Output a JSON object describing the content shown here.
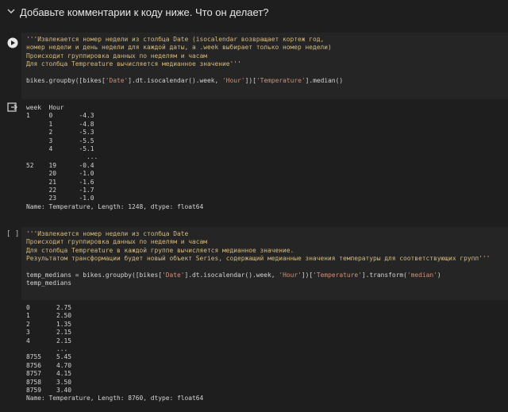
{
  "section": {
    "title": "Добавьте комментарии к коду ниже. Что он делает?"
  },
  "cell1": {
    "doc_lines": [
      "'''Извлекается номер недели из столбца Date (isocalendar возвращает кортеж год,",
      "номер недели и день недели для каждой даты, а .week выбирает только номер недели)",
      "Происходит группировка данных по неделям и часам",
      "Для столбца Tempreature вычисляется медианное значение'''"
    ],
    "code": {
      "p1": "bikes.groupby([bikes[",
      "s1": "'Date'",
      "p2": "].dt.isocalendar().week, ",
      "s2": "'Hour'",
      "p3": "])[",
      "s3": "'Temperature'",
      "p4": "].median()"
    },
    "output": {
      "header": "week  Hour",
      "rows": [
        "1     0       -4.3",
        "      1       -4.8",
        "      2       -5.3",
        "      3       -5.5",
        "      4       -5.1",
        "                ...",
        "52    19      -0.4",
        "      20      -1.0",
        "      21      -1.6",
        "      22      -1.7",
        "      23      -1.0"
      ],
      "footer": "Name: Temperature, Length: 1248, dtype: float64"
    }
  },
  "cell2": {
    "prompt": "[ ]",
    "doc_lines": [
      "'''Извлекается номер недели из столбца Date",
      "Происходит группировка данных по неделям и часам",
      "Для столбца Tempreature в каждой группе вычисляется медианное значение.",
      "Результатом трансформации будет новый объект Series, содержащий медианные значения температуры для соответствующих групп'''"
    ],
    "code": {
      "p1": "temp_medians = bikes.groupby([bikes[",
      "s1": "'Date'",
      "p2": "].dt.isocalendar().week, ",
      "s2": "'Hour'",
      "p3": "])[",
      "s3": "'Temperature'",
      "p4": "].transform(",
      "s4": "'median'",
      "p5": ")",
      "line2": "temp_medians"
    },
    "output": {
      "rows": [
        "0       2.75",
        "1       2.50",
        "2       1.35",
        "3       2.15",
        "4       2.15",
        "        ...",
        "8755    5.45",
        "8756    4.70",
        "8757    4.15",
        "8758    3.50",
        "8759    3.40"
      ],
      "footer": "Name: Temperature, Length: 8760, dtype: float64"
    }
  }
}
